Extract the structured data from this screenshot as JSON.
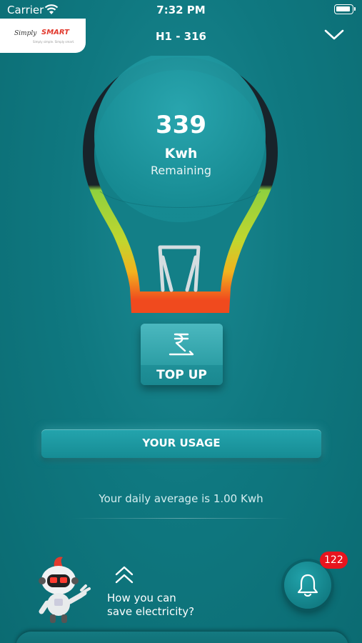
{
  "status_bar": {
    "carrier": "Carrier",
    "time": "7:32 PM"
  },
  "header": {
    "logo": {
      "simply": "Simply",
      "smart": "SMART",
      "tagline": "Simply simple. Simply smart."
    },
    "title": "H1 - 316"
  },
  "meter": {
    "value": "339",
    "unit": "Kwh",
    "label": "Remaining"
  },
  "actions": {
    "topup_label": "TOP UP",
    "usage_label": "YOUR USAGE"
  },
  "usage": {
    "daily_average": "Your daily average is 1.00 Kwh"
  },
  "tips": {
    "line1": "How you can",
    "line2": "save electricity?"
  },
  "notifications": {
    "count": "122"
  },
  "icons": {
    "wifi": "wifi-icon",
    "battery": "battery-icon",
    "dropdown": "chevron-down-icon",
    "rupee": "rupee-icon",
    "chevrons": "double-chevron-up-icon",
    "bell": "bell-icon",
    "mascot": "robot-mascot"
  },
  "colors": {
    "background": "#0f7880",
    "badge": "#e8141e",
    "bulb_green": "#8ed13f",
    "bulb_yellow": "#e6d22a",
    "bulb_red": "#f04a1e"
  }
}
